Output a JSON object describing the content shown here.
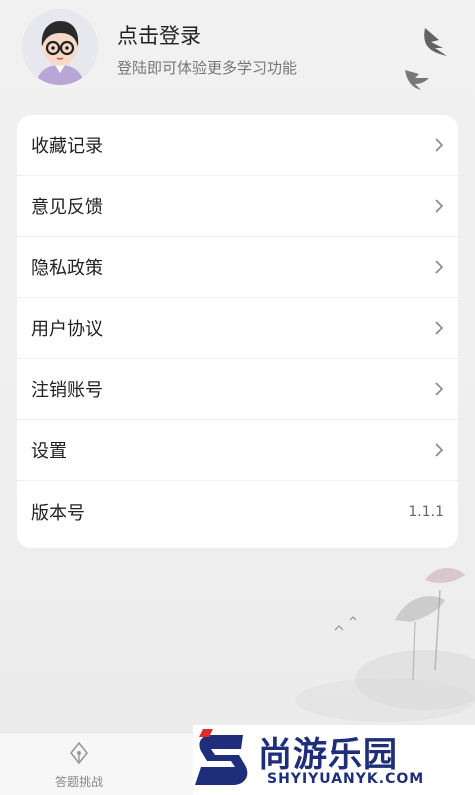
{
  "profile": {
    "title": "点击登录",
    "subtitle": "登陆即可体验更多学习功能"
  },
  "menu": {
    "items": [
      {
        "label": "收藏记录"
      },
      {
        "label": "意见反馈"
      },
      {
        "label": "隐私政策"
      },
      {
        "label": "用户协议"
      },
      {
        "label": "注销账号"
      },
      {
        "label": "设置"
      }
    ],
    "version_label": "版本号",
    "version_value": "1.1.1"
  },
  "nav": {
    "tab_label": "答题挑战"
  },
  "watermark": {
    "brand": "尚游乐园",
    "url": "SHYIYUANYK.COM"
  },
  "colors": {
    "brand_blue": "#1f2e7a",
    "accent_red": "#e02a2a"
  },
  "icons": {
    "avatar": "cartoon-avatar",
    "menu_chevron": "chevron-right-icon",
    "tab_icon": "pen-nib-icon",
    "decoration": "swallow-birds"
  }
}
